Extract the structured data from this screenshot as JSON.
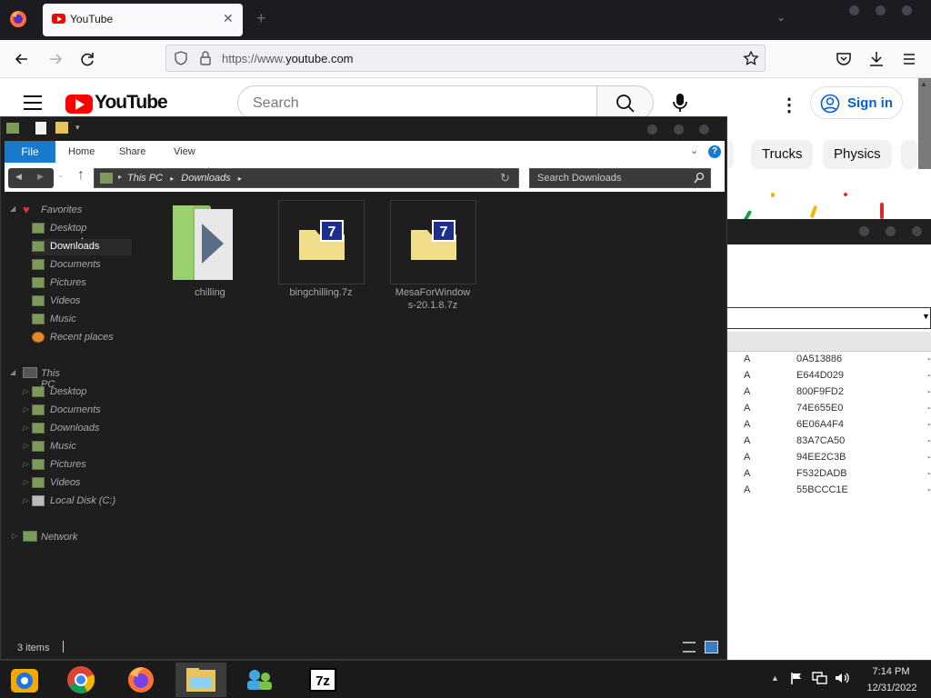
{
  "browser": {
    "tab_title": "YouTube",
    "url_prefix": "https://www.",
    "url_domain": "youtube.com"
  },
  "youtube": {
    "wordmark": "YouTube",
    "search_placeholder": "Search",
    "sign_in": "Sign in",
    "chips": [
      "Trucks",
      "Physics"
    ]
  },
  "explorer": {
    "ribbon": {
      "file": "File",
      "tabs": [
        "Home",
        "Share",
        "View"
      ]
    },
    "path": [
      "This PC",
      "Downloads"
    ],
    "search_placeholder": "Search Downloads",
    "nav": {
      "favorites": "Favorites",
      "favorites_items": [
        "Desktop",
        "Downloads",
        "Documents",
        "Pictures",
        "Videos",
        "Music",
        "Recent places"
      ],
      "this_pc": "This PC",
      "pc_items": [
        "Desktop",
        "Documents",
        "Downloads",
        "Music",
        "Pictures",
        "Videos",
        "Local Disk (C:)"
      ],
      "network": "Network"
    },
    "files": [
      {
        "name": "chilling",
        "type": "folder"
      },
      {
        "name": "bingchilling.7z",
        "type": "7z"
      },
      {
        "name": "MesaForWindows-20.1.8.7z",
        "name_line1": "MesaForWindow",
        "name_line2": "s-20.1.8.7z",
        "type": "7z"
      }
    ],
    "status": "3 items"
  },
  "background_window": {
    "rows": [
      {
        "attr": "A",
        "crc": "0A513886"
      },
      {
        "attr": "A",
        "crc": "E644D029"
      },
      {
        "attr": "A",
        "crc": "800F9FD2"
      },
      {
        "attr": "A",
        "crc": "74E655E0"
      },
      {
        "attr": "A",
        "crc": "6E06A4F4"
      },
      {
        "attr": "A",
        "crc": "83A7CA50"
      },
      {
        "attr": "A",
        "crc": "94EE2C3B"
      },
      {
        "attr": "A",
        "crc": "F532DADB"
      },
      {
        "attr": "A",
        "crc": "55BCCC1E"
      }
    ]
  },
  "taskbar": {
    "apps": [
      "chrome-colorful-icon",
      "chrome-icon",
      "firefox-icon",
      "file-explorer-icon",
      "network-users-icon",
      "7zip-icon"
    ],
    "time": "7:14 PM",
    "date": "12/31/2022"
  },
  "colors": {
    "youtube_red": "#ff0000",
    "ribbon_blue": "#1979ca",
    "explorer_bg": "#1e1e1e",
    "taskbar_bg": "#1a1a1a"
  }
}
